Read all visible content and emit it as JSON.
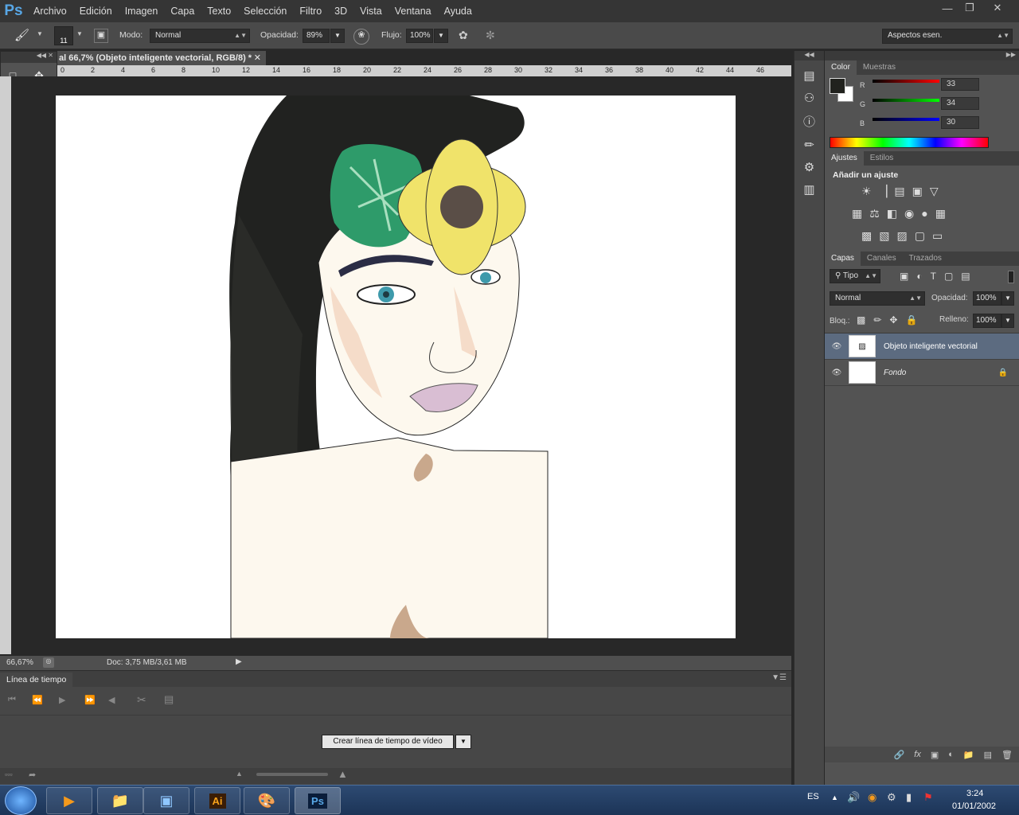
{
  "app": {
    "logo": "Ps"
  },
  "menu": [
    "Archivo",
    "Edición",
    "Imagen",
    "Capa",
    "Texto",
    "Selección",
    "Filtro",
    "3D",
    "Vista",
    "Ventana",
    "Ayuda"
  ],
  "options": {
    "brush_size": "11",
    "mode_label": "Modo:",
    "mode_value": "Normal",
    "opacity_label": "Opacidad:",
    "opacity_value": "89%",
    "flow_label": "Flujo:",
    "flow_value": "100%",
    "workspace": "Aspectos esen."
  },
  "document": {
    "tab_title": "al 66,7% (Objeto inteligente vectorial, RGB/8) *",
    "ruler_top": [
      "0",
      "2",
      "4",
      "6",
      "8",
      "10",
      "12",
      "14",
      "16",
      "18",
      "20",
      "22",
      "24",
      "26",
      "28",
      "30",
      "32",
      "34",
      "36",
      "38",
      "40",
      "42",
      "44",
      "46"
    ]
  },
  "status": {
    "zoom": "66,67%",
    "doc": "Doc: 3,75 MB/3,61 MB"
  },
  "timeline": {
    "title": "Línea de tiempo",
    "create_button": "Crear línea de tiempo de vídeo"
  },
  "color_panel": {
    "tabs": [
      "Color",
      "Muestras"
    ],
    "r_label": "R",
    "r_value": "33",
    "g_label": "G",
    "g_value": "34",
    "b_label": "B",
    "b_value": "30"
  },
  "adjust_panel": {
    "tabs": [
      "Ajustes",
      "Estilos"
    ],
    "title": "Añadir un ajuste"
  },
  "layers_panel": {
    "tabs": [
      "Capas",
      "Canales",
      "Trazados"
    ],
    "filter": "Tipo",
    "blend": "Normal",
    "opacity_label": "Opacidad:",
    "opacity_value": "100%",
    "lock_label": "Bloq.:",
    "fill_label": "Relleno:",
    "fill_value": "100%",
    "layers": [
      {
        "name": "Objeto inteligente vectorial"
      },
      {
        "name": "Fondo"
      }
    ]
  },
  "taskbar": {
    "lang": "ES",
    "time": "3:24",
    "date": "01/01/2002"
  },
  "colors": {
    "foreground": "#21221e",
    "background": "#ffffff",
    "accent": "#58a7e6"
  }
}
